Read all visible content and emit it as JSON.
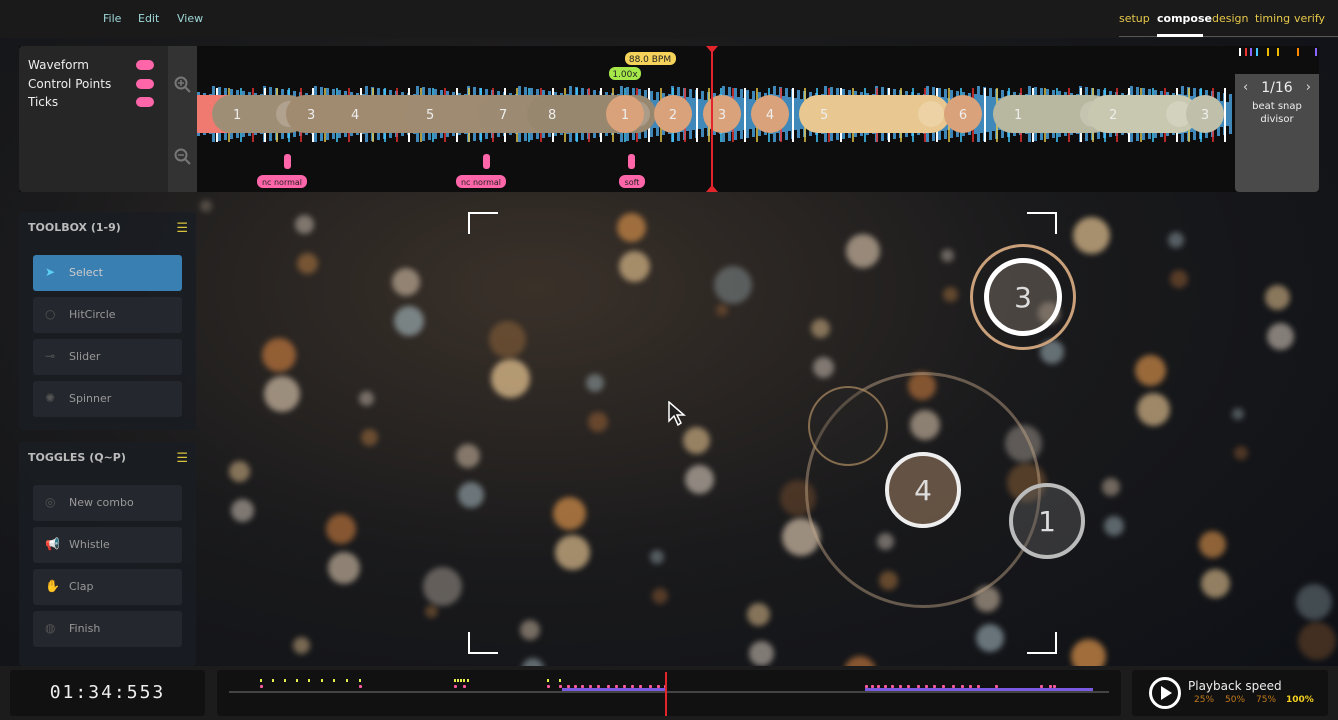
{
  "menu": {
    "file": "File",
    "edit": "Edit",
    "view": "View"
  },
  "tabs": [
    {
      "label": "setup"
    },
    {
      "label": "compose",
      "active": true
    },
    {
      "label": "design"
    },
    {
      "label": "timing"
    },
    {
      "label": "verify"
    }
  ],
  "timeline": {
    "toggles": [
      {
        "label": "Waveform",
        "on": true
      },
      {
        "label": "Control Points",
        "on": true
      },
      {
        "label": "Ticks",
        "on": true
      }
    ],
    "bpm": "88.0 BPM",
    "speed": "1.00x",
    "combo_numbers": [
      "1",
      "3",
      "4",
      "5",
      "7",
      "8",
      "1",
      "2",
      "3",
      "4",
      "5",
      "6",
      "1",
      "2",
      "3"
    ],
    "samples": [
      {
        "label": "normal",
        "prefix": "nc"
      },
      {
        "label": "normal",
        "prefix": "nc"
      },
      {
        "label": "soft"
      }
    ],
    "zoom_in": "zoom-in-icon",
    "zoom_out": "zoom-out-icon"
  },
  "beat_snap": {
    "value": "1/16",
    "label1": "beat snap",
    "label2": "divisor"
  },
  "toolbox": {
    "title": "TOOLBOX (1-9)",
    "items": [
      {
        "label": "Select",
        "selected": true
      },
      {
        "label": "HitCircle"
      },
      {
        "label": "Slider"
      },
      {
        "label": "Spinner"
      }
    ]
  },
  "toggles": {
    "title": "TOGGLES (Q~P)",
    "items": [
      {
        "label": "New combo"
      },
      {
        "label": "Whistle"
      },
      {
        "label": "Clap"
      },
      {
        "label": "Finish"
      }
    ]
  },
  "playfield": {
    "hit_objects": [
      "3",
      "4",
      "1"
    ]
  },
  "time": "01:34:553",
  "playback": {
    "label": "Playback speed",
    "options": [
      "25%",
      "50%",
      "75%",
      "100%"
    ],
    "selected": "100%"
  },
  "colors": {
    "accent": "#ff66aa",
    "tab": "#e6c84a",
    "playhead": "#e2252b",
    "select": "#3a7fb2"
  }
}
